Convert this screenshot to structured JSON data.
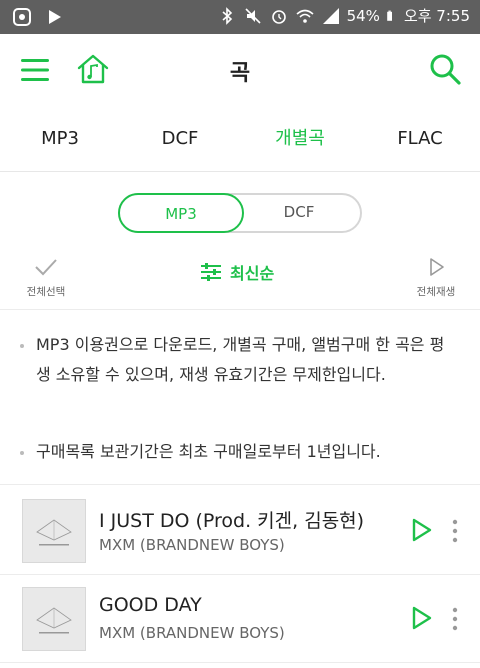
{
  "status_bar": {
    "battery": "54%",
    "time": "오후 7:55"
  },
  "app_bar": {
    "title": "곡",
    "menu_icon": "hamburger-menu-icon",
    "home_icon": "music-home-icon",
    "search_icon": "search-icon"
  },
  "tabs": [
    {
      "label": "MP3",
      "active": false
    },
    {
      "label": "DCF",
      "active": false
    },
    {
      "label": "개별곡",
      "active": true
    },
    {
      "label": "FLAC",
      "active": false
    }
  ],
  "segment": {
    "selected": "MP3",
    "other": "DCF"
  },
  "actions": {
    "select_all": "전체선택",
    "sort": "최신순",
    "play_all": "전체재생"
  },
  "notices": [
    "MP3 이용권으로 다운로드, 개별곡 구매, 앨범구매 한 곡은 평생 소유할 수 있으며, 재생 유효기간은 무제한입니다.",
    "구매목록 보관기간은 최초 구매일로부터 1년입니다."
  ],
  "tracks": [
    {
      "title": "I JUST DO (Prod. 키겐, 김동현)",
      "artist": "MXM (BRANDNEW BOYS)"
    },
    {
      "title": "GOOD DAY",
      "artist": "MXM (BRANDNEW BOYS)"
    }
  ],
  "colors": {
    "accent": "#1ec04a",
    "status_bar": "#5f5f5f"
  }
}
